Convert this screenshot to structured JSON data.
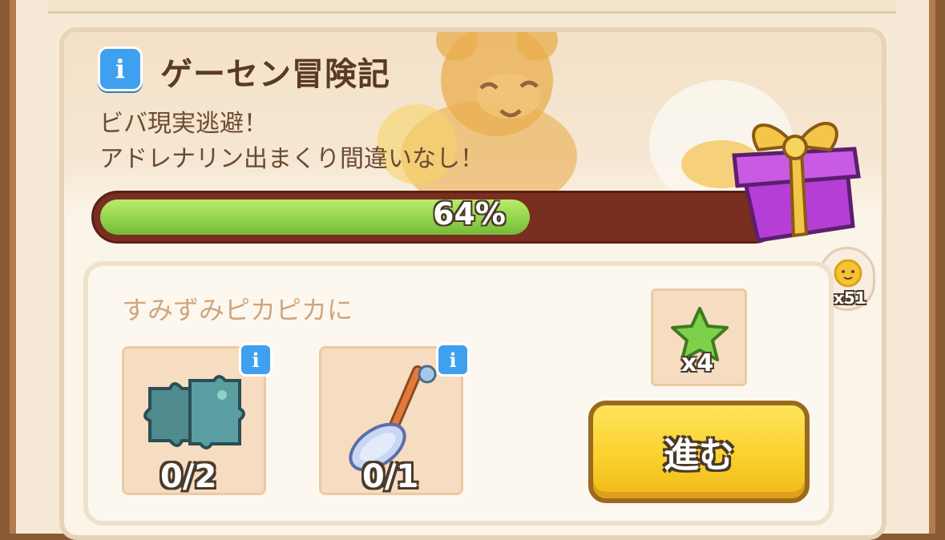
{
  "event": {
    "title": "ゲーセン冒険記",
    "desc_line1": "ビバ現実逃避！",
    "desc_line2": "アドレナリン出まくり間違いなし！",
    "progress_percent": 64,
    "progress_label": "64%"
  },
  "reward_badge": {
    "count_label": "x51",
    "icon": "sun-icon"
  },
  "task": {
    "title": "すみずみピカピカに",
    "items": [
      {
        "icon": "puzzle-pieces-icon",
        "count": "0/2"
      },
      {
        "icon": "duster-icon",
        "count": "0/1"
      }
    ],
    "reward": {
      "icon": "green-star-icon",
      "count": "x4"
    },
    "go_label": "進む"
  },
  "colors": {
    "progress_fill": "#8fd24a",
    "progress_track": "#7a2e1f",
    "info_blue": "#3fa0f0",
    "button_yellow": "#f9cf2a"
  }
}
